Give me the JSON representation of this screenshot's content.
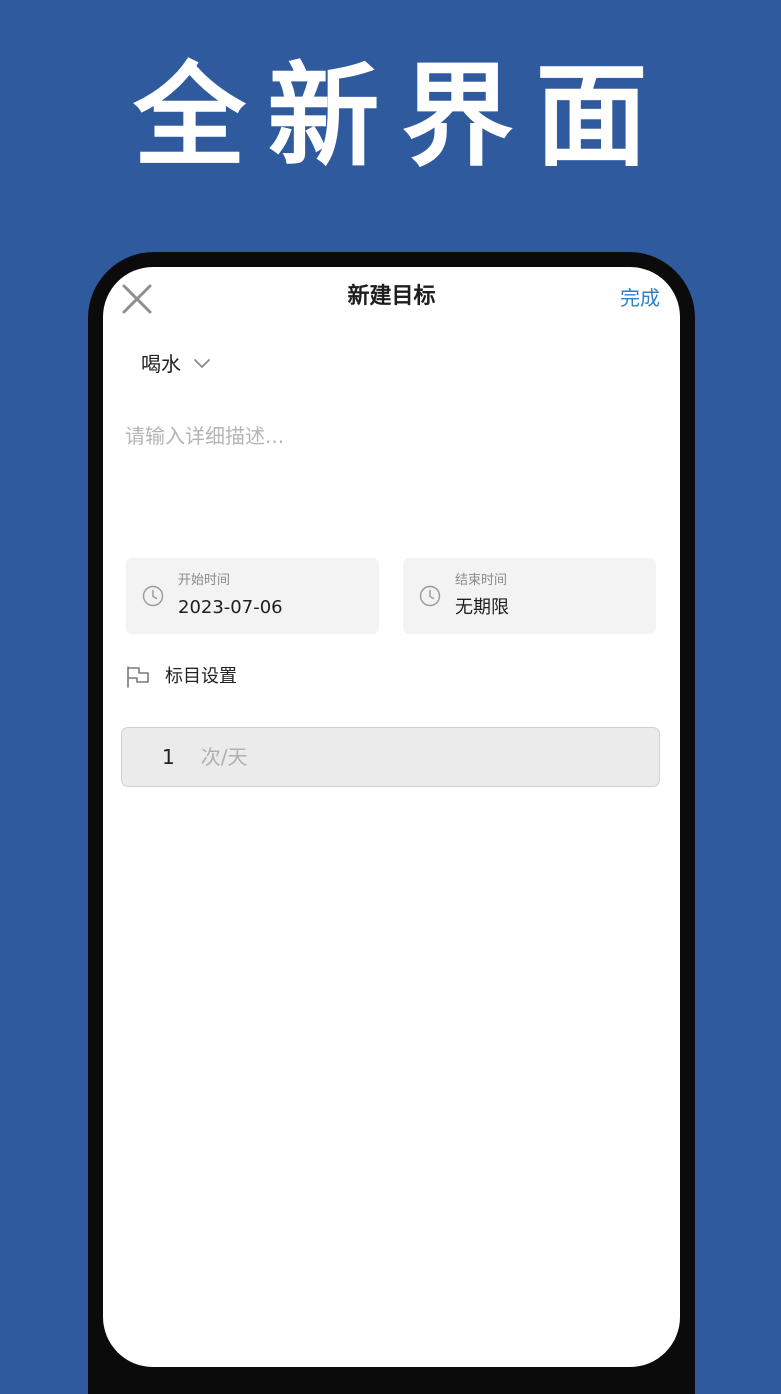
{
  "promo": {
    "headline": "全新界面"
  },
  "header": {
    "title": "新建目标",
    "done_label": "完成",
    "close_icon": "close-icon"
  },
  "category": {
    "selected": "喝水",
    "icon": "chevron-down-icon"
  },
  "description": {
    "value": "",
    "placeholder": "请输入详细描述..."
  },
  "start_time": {
    "caption": "开始时间",
    "value": "2023-07-06",
    "icon": "clock-icon"
  },
  "end_time": {
    "caption": "结束时间",
    "value": "无期限",
    "icon": "clock-icon"
  },
  "target": {
    "label": "标目设置",
    "icon": "flag-icon"
  },
  "frequency": {
    "value": "1",
    "unit": "次/天"
  },
  "colors": {
    "background": "#2f5a9e",
    "accent": "#2f7fc4",
    "card": "#f3f3f3",
    "input": "#ebebeb"
  }
}
